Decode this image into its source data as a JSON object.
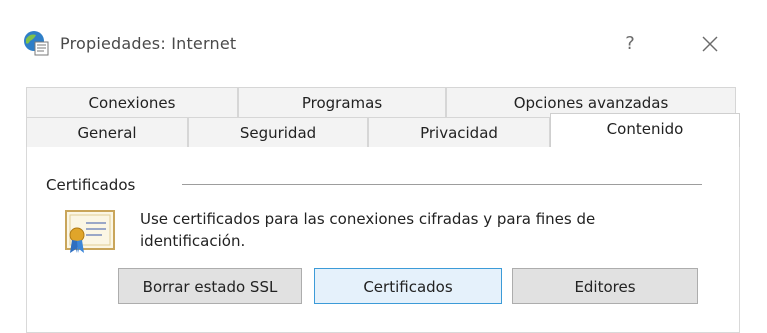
{
  "window": {
    "title": "Propiedades: Internet",
    "help_label": "?",
    "close_label": "✕"
  },
  "tabs": {
    "back_row": [
      "Conexiones",
      "Programas",
      "Opciones avanzadas"
    ],
    "front_row": [
      "General",
      "Seguridad",
      "Privacidad",
      "Contenido"
    ],
    "active": "Contenido"
  },
  "certificates": {
    "group_label": "Certificados",
    "description": "Use certificados para las conexiones cifradas y para fines de identificación.",
    "buttons": {
      "clear_ssl": "Borrar estado SSL",
      "certificates": "Certificados",
      "publishers": "Editores"
    }
  },
  "colors": {
    "focus_border": "#3c9bd8",
    "focus_fill": "#e5f1fb",
    "button_fill": "#e1e1e1"
  }
}
